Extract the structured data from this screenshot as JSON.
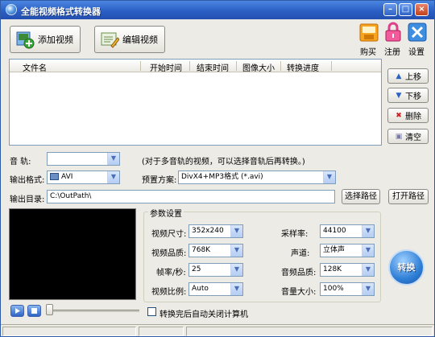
{
  "window": {
    "title": "全能视频格式转换器",
    "minimize": "–",
    "maximize": "□",
    "close": "×"
  },
  "toolbar": {
    "add_video": "添加视频",
    "edit_video": "编辑视频",
    "buy": "购买",
    "register": "注册",
    "settings": "设置"
  },
  "filelist": {
    "columns": [
      "文件名",
      "开始时间",
      "结束时间",
      "图像大小",
      "转换进度"
    ],
    "rows": []
  },
  "side_buttons": {
    "up": "上移",
    "down": "下移",
    "delete": "删除",
    "clear": "清空"
  },
  "audio_track": {
    "label": "音    轨:",
    "value": "",
    "hint": "(对于多音轨的视频，可以选择音轨后再转换。)"
  },
  "output_format": {
    "label": "输出格式:",
    "value": "AVI"
  },
  "preset": {
    "label": "预置方案:",
    "value": "DivX4+MP3格式 (*.avi)"
  },
  "output_dir": {
    "label": "输出目录:",
    "value": "C:\\OutPath\\",
    "choose": "选择路径",
    "open": "打开路径"
  },
  "params": {
    "title": "参数设置",
    "video_size": {
      "label": "视频尺寸:",
      "value": "352x240"
    },
    "video_quality": {
      "label": "视频品质:",
      "value": "768K"
    },
    "frame_rate": {
      "label": "帧率/秒:",
      "value": "25"
    },
    "aspect": {
      "label": "视频比例:",
      "value": "Auto"
    },
    "sample_rate": {
      "label": "采样率:",
      "value": "44100"
    },
    "channels": {
      "label": "声道:",
      "value": "立体声"
    },
    "audio_quality": {
      "label": "音频品质:",
      "value": "128K"
    },
    "volume": {
      "label": "音量大小:",
      "value": "100%"
    }
  },
  "convert_button": "转换",
  "auto_shutdown": {
    "label": "转换完后自动关闭计算机",
    "checked": false
  },
  "player": {
    "volume_level": 0.0
  },
  "colors": {
    "title_bar": "#2b5fc4",
    "window_bg": "#ecebe6",
    "preview_bg": "#000000"
  }
}
